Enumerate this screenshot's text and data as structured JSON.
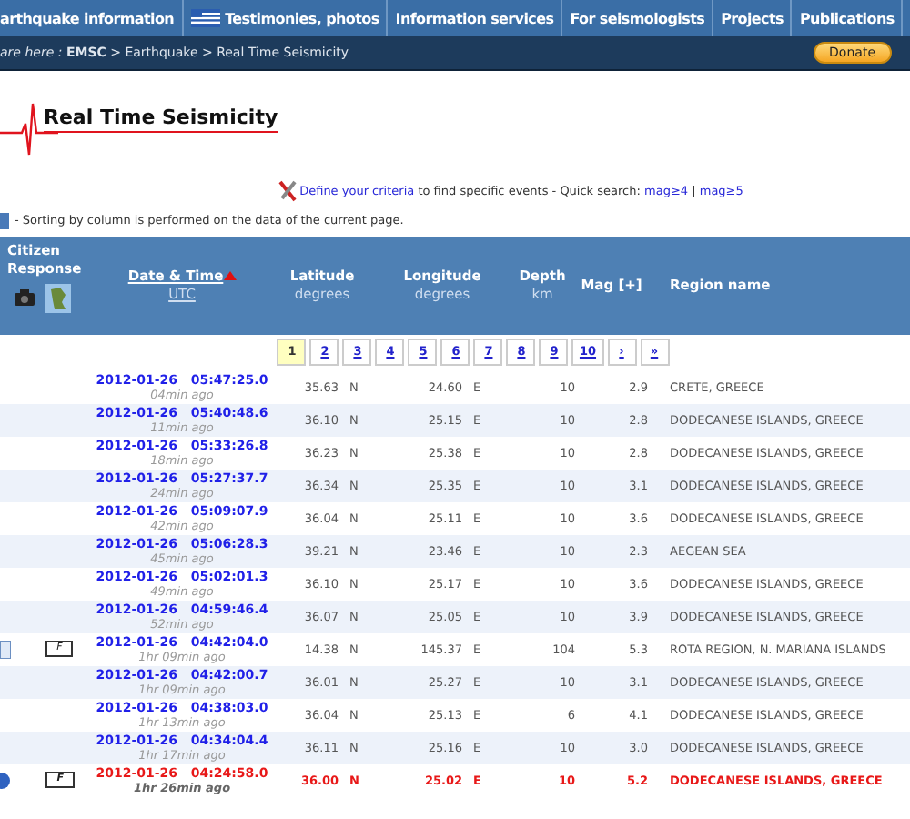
{
  "nav": {
    "items": [
      {
        "label": "arthquake information",
        "flag": false
      },
      {
        "label": "Testimonies, photos",
        "flag": true
      },
      {
        "label": "Information services",
        "flag": false
      },
      {
        "label": "For seismologists",
        "flag": false
      },
      {
        "label": "Projects",
        "flag": false
      },
      {
        "label": "Publications",
        "flag": false
      }
    ]
  },
  "breadcrumb": "*are here :* **EMSC** > Earthquake > Real Time Seismicity",
  "donate": "Donate",
  "title": "Real Time Seismicity",
  "criteria": {
    "link": "Define your criteria",
    "text": "to find specific events - Quick search:",
    "quick": [
      "mag≥4",
      "mag≥5"
    ],
    "separator": "|"
  },
  "sorting_note": "- Sorting by column is performed on the data of the current page.",
  "table": {
    "columns": [
      {
        "kind": "citizen",
        "title": "Citizen",
        "subtitle": "Response"
      },
      {
        "kind": "date",
        "title": "Date & Time",
        "subtitle": "UTC"
      },
      {
        "kind": "lat",
        "title": "Latitude",
        "subtitle": "degrees"
      },
      {
        "kind": "lon",
        "title": "Longitude",
        "subtitle": "degrees"
      },
      {
        "kind": "depth",
        "title": "Depth",
        "subtitle": "km"
      },
      {
        "kind": "mag",
        "title": "Mag [+]"
      },
      {
        "kind": "region",
        "title": "Region name"
      }
    ],
    "pages": [
      {
        "label": "1",
        "selected": true
      },
      {
        "label": "2",
        "selected": false
      },
      {
        "label": "3",
        "selected": false
      },
      {
        "label": "4",
        "selected": false
      },
      {
        "label": "5",
        "selected": false
      },
      {
        "label": "6",
        "selected": false
      },
      {
        "label": "7",
        "selected": false
      },
      {
        "label": "8",
        "selected": false
      },
      {
        "label": "9",
        "selected": false
      },
      {
        "label": "10",
        "selected": false
      },
      {
        "label": "›",
        "selected": false
      },
      {
        "label": "»",
        "selected": false
      }
    ],
    "rows": [
      {
        "date": "2012-01-26",
        "time": "05:47:25.0",
        "ago": "04min ago",
        "lat": "35.63",
        "ns": "N",
        "lon": "24.60",
        "ew": "E",
        "depth": "10",
        "mag": "2.9",
        "region": "CRETE, GREECE",
        "highlight": false
      },
      {
        "date": "2012-01-26",
        "time": "05:40:48.6",
        "ago": "11min ago",
        "lat": "36.10",
        "ns": "N",
        "lon": "25.15",
        "ew": "E",
        "depth": "10",
        "mag": "2.8",
        "region": "DODECANESE ISLANDS, GREECE",
        "highlight": false
      },
      {
        "date": "2012-01-26",
        "time": "05:33:26.8",
        "ago": "18min ago",
        "lat": "36.23",
        "ns": "N",
        "lon": "25.38",
        "ew": "E",
        "depth": "10",
        "mag": "2.8",
        "region": "DODECANESE ISLANDS, GREECE",
        "highlight": false
      },
      {
        "date": "2012-01-26",
        "time": "05:27:37.7",
        "ago": "24min ago",
        "lat": "36.34",
        "ns": "N",
        "lon": "25.35",
        "ew": "E",
        "depth": "10",
        "mag": "3.1",
        "region": "DODECANESE ISLANDS, GREECE",
        "highlight": false
      },
      {
        "date": "2012-01-26",
        "time": "05:09:07.9",
        "ago": "42min ago",
        "lat": "36.04",
        "ns": "N",
        "lon": "25.11",
        "ew": "E",
        "depth": "10",
        "mag": "3.6",
        "region": "DODECANESE ISLANDS, GREECE",
        "highlight": false
      },
      {
        "date": "2012-01-26",
        "time": "05:06:28.3",
        "ago": "45min ago",
        "lat": "39.21",
        "ns": "N",
        "lon": "23.46",
        "ew": "E",
        "depth": "10",
        "mag": "2.3",
        "region": "AEGEAN SEA",
        "highlight": false
      },
      {
        "date": "2012-01-26",
        "time": "05:02:01.3",
        "ago": "49min ago",
        "lat": "36.10",
        "ns": "N",
        "lon": "25.17",
        "ew": "E",
        "depth": "10",
        "mag": "3.6",
        "region": "DODECANESE ISLANDS, GREECE",
        "highlight": false
      },
      {
        "date": "2012-01-26",
        "time": "04:59:46.4",
        "ago": "52min ago",
        "lat": "36.07",
        "ns": "N",
        "lon": "25.05",
        "ew": "E",
        "depth": "10",
        "mag": "3.9",
        "region": "DODECANESE ISLANDS, GREECE",
        "highlight": false
      },
      {
        "date": "2012-01-26",
        "time": "04:42:04.0",
        "ago": "1hr 09min ago",
        "lat": "14.38",
        "ns": "N",
        "lon": "145.37",
        "ew": "E",
        "depth": "104",
        "mag": "5.3",
        "region": "ROTA REGION, N. MARIANA ISLANDS",
        "highlight": false,
        "citizen": {
          "kind": "document",
          "felt": "F"
        }
      },
      {
        "date": "2012-01-26",
        "time": "04:42:00.7",
        "ago": "1hr 09min ago",
        "lat": "36.01",
        "ns": "N",
        "lon": "25.27",
        "ew": "E",
        "depth": "10",
        "mag": "3.1",
        "region": "DODECANESE ISLANDS, GREECE",
        "highlight": false
      },
      {
        "date": "2012-01-26",
        "time": "04:38:03.0",
        "ago": "1hr 13min ago",
        "lat": "36.04",
        "ns": "N",
        "lon": "25.13",
        "ew": "E",
        "depth": "6",
        "mag": "4.1",
        "region": "DODECANESE ISLANDS, GREECE",
        "highlight": false
      },
      {
        "date": "2012-01-26",
        "time": "04:34:04.4",
        "ago": "1hr 17min ago",
        "lat": "36.11",
        "ns": "N",
        "lon": "25.16",
        "ew": "E",
        "depth": "10",
        "mag": "3.0",
        "region": "DODECANESE ISLANDS, GREECE",
        "highlight": false
      },
      {
        "date": "2012-01-26",
        "time": "04:24:58.0",
        "ago": "1hr 26min ago",
        "lat": "36.00",
        "ns": "N",
        "lon": "25.02",
        "ew": "E",
        "depth": "10",
        "mag": "5.2",
        "region": "DODECANESE ISLANDS, GREECE",
        "highlight": true,
        "citizen": {
          "kind": "globe",
          "felt": "F"
        }
      }
    ]
  }
}
